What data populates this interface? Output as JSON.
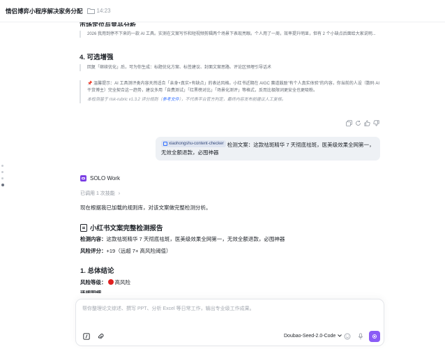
{
  "header": {
    "title": "情侣博弈小程序解决家务分配",
    "time": "14:23"
  },
  "content": {
    "cut_heading": "市场定位与竞品分析",
    "quote_1": "2026 我用到停不下来的一款 AI 工具。实测在文案写作和短视频剪辑两个场景下表现亮眼。个人用了一周，效率提升明显，但有 2 个小缺点后面给大家说明...",
    "section_4_title": "4. 可选增强",
    "quote_2": "回复「继续优化」后，可为你生成：标题优化方案、标签建议、封面文案思路、评论区预埋引导话术",
    "note_line_1": "📌 温馨提示：AI 工具测评类内容天然适合「亲身+真实+有缺点」的表达风格。小红书近期在 AIGC 赛道鼓励\"有个人真实体验\"的内容，你当前的人设（数码 AI 干货博主）完全契合这一趋势，建议多用「自费测试」「红黑榜对比」「场景化测评」等格式，反而比极限词更安全也更吸粉。",
    "note_line_2_prefix": "本检测基于 risk-rubric v1.3.2 评分规则（",
    "note_line_2_link": "参考文件",
    "note_line_2_suffix": "），不代表平台官方判定，最终内容发布前建议人工复核。",
    "user_tag": "xiaohongshu-content-checker",
    "user_message": " 检测文案：这款祛斑精华 7 天彻底祛斑，医美级效果全网第一，无效全额退款，必囤神器",
    "bot_name": "SOLO Work",
    "skills": "已调用 1 次技能",
    "intro": "现在根据我已加载的规则库，对该文案做完整检测分析。",
    "report_title": "小红书文案完整检测报告",
    "content_label": "检测内容：",
    "content_value": "这款祛斑精华 7 天彻底祛斑，医美级效果全网第一，无效全额退款，必囤神器",
    "score_label": "风险评分：",
    "score_value": "+19（远超 7+ 高风险阈值）",
    "section_1_title": "1. 总体结论",
    "risk_label": "风险等级：",
    "risk_value": "高风险",
    "cut_bottom": "违规明细"
  },
  "composer": {
    "placeholder": "帮你整理论文综述、撰写 PPT、分析 Excel 等日常工作，输出专业级工作成果。",
    "model": "Doubao-Seed-2.0-Code"
  },
  "colors": {
    "accent": "#8a5cf6",
    "link": "#3370ff",
    "risk": "#e02020",
    "bubble": "#eef1f5"
  }
}
